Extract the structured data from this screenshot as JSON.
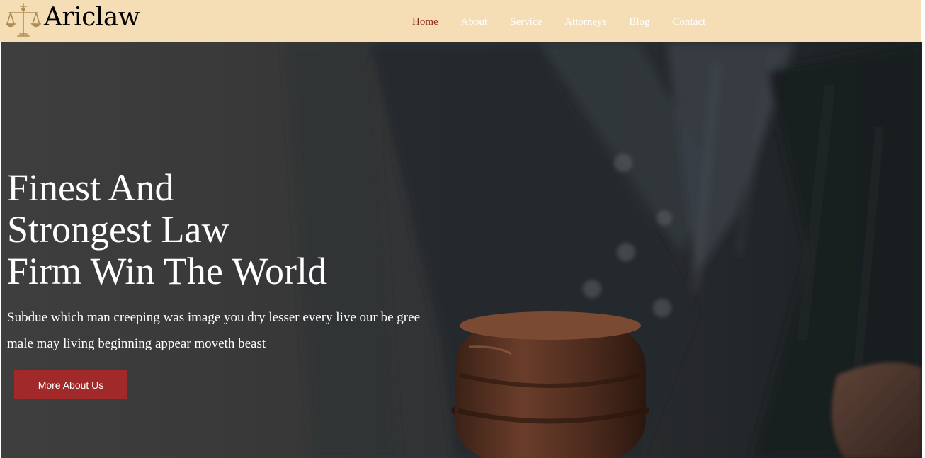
{
  "header": {
    "brand": {
      "name": "Ariclaw",
      "icon": "scales-of-justice-icon",
      "icon_color": "#b08d57"
    },
    "background": "#f5deb6",
    "nav": {
      "items": [
        {
          "label": "Home",
          "active": true
        },
        {
          "label": "About",
          "active": false
        },
        {
          "label": "Service",
          "active": false
        },
        {
          "label": "Attorneys",
          "active": false
        },
        {
          "label": "Blog",
          "active": false
        },
        {
          "label": "Contact",
          "active": false
        }
      ],
      "active_color": "#8e2a22",
      "color": "#ffffff"
    }
  },
  "hero": {
    "title_lines": [
      "Finest And",
      "Strongest Law",
      "Firm Win The World"
    ],
    "description_lines": [
      "Subdue which man creeping was image you dry lesser every live our be gree",
      "male may living beginning appear moveth beast"
    ],
    "cta_label": "More About Us",
    "cta_color": "#a2292a",
    "background_image": "dark-suit-with-wooden-gavel"
  }
}
